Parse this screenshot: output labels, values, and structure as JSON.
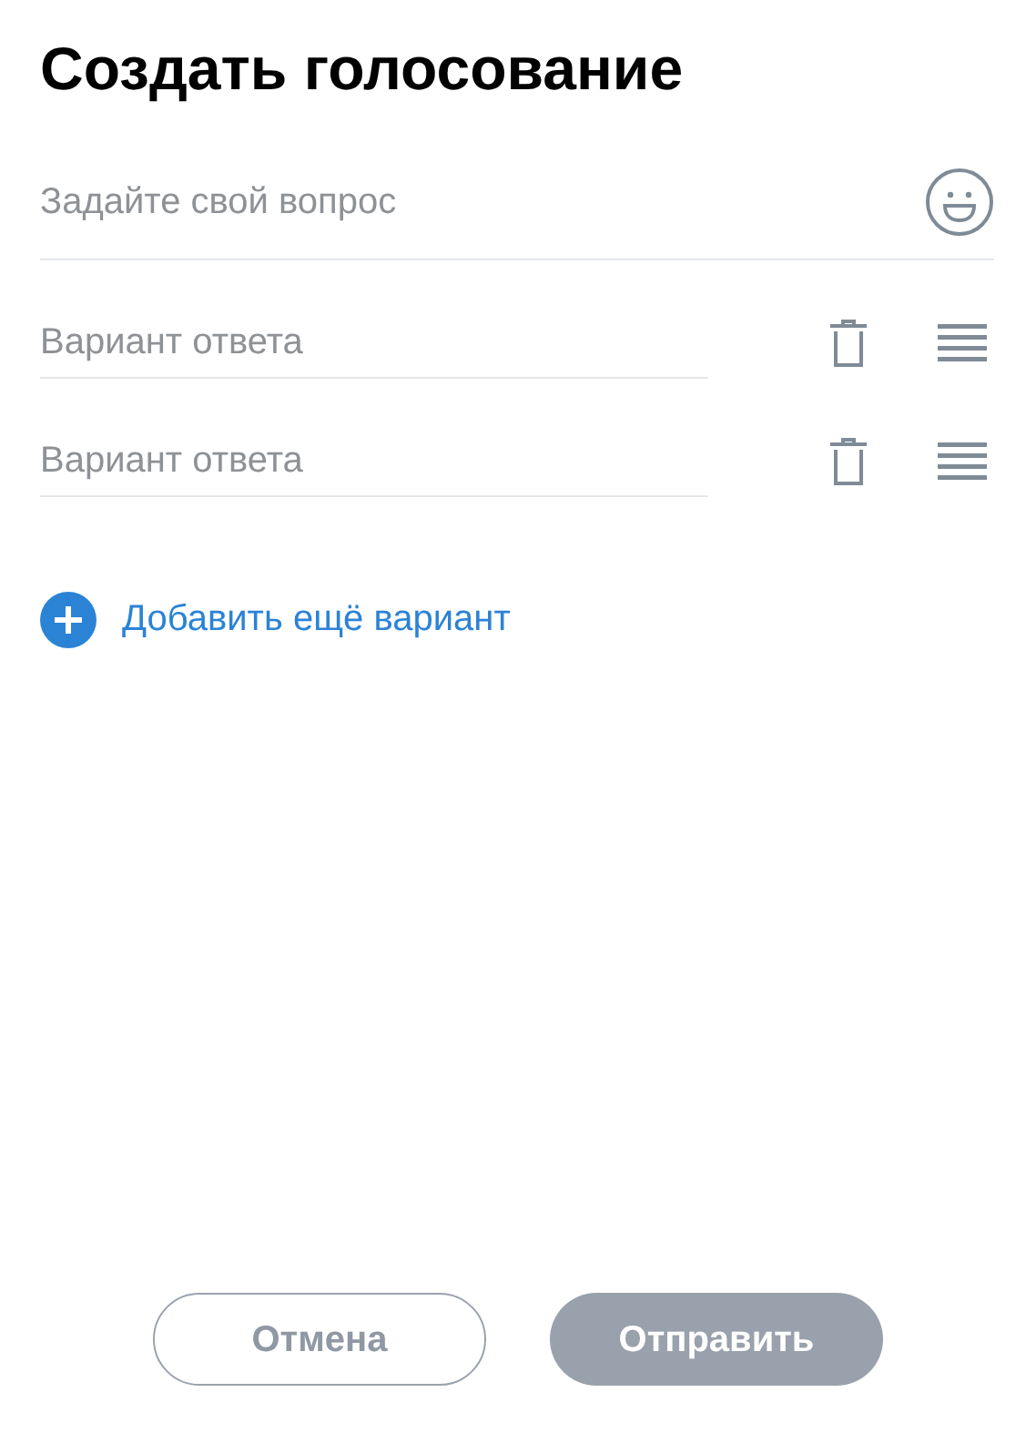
{
  "title": "Создать голосование",
  "question": {
    "placeholder": "Задайте свой вопрос"
  },
  "options": [
    {
      "placeholder": "Вариант ответа"
    },
    {
      "placeholder": "Вариант ответа"
    }
  ],
  "add_option": "Добавить ещё вариант",
  "buttons": [
    {
      "kind": "secondary",
      "label": "Отмена",
      "disabled": false
    },
    {
      "kind": "primary",
      "label": "Отправить",
      "disabled": true
    }
  ]
}
